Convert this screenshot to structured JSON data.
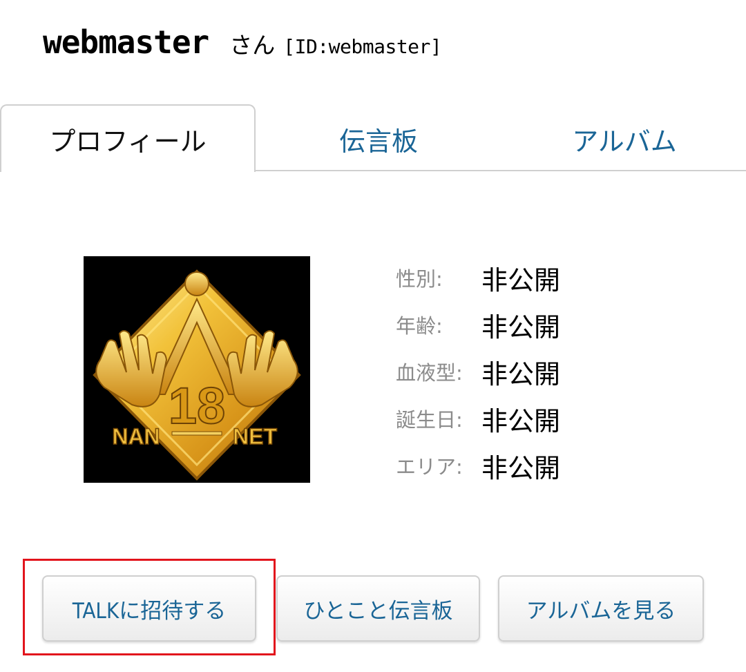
{
  "profile": {
    "username": "webmaster",
    "honorific": "さん",
    "id_label": "[ID:webmaster]"
  },
  "tabs": [
    {
      "label": "プロフィール",
      "active": true
    },
    {
      "label": "伝言板",
      "active": false
    },
    {
      "label": "アルバム",
      "active": false
    }
  ],
  "avatar": {
    "number": "18",
    "left_text": "NAN",
    "right_text": "NET"
  },
  "info": [
    {
      "label": "性別:",
      "value": "非公開"
    },
    {
      "label": "年齢:",
      "value": "非公開"
    },
    {
      "label": "血液型:",
      "value": "非公開"
    },
    {
      "label": "誕生日:",
      "value": "非公開"
    },
    {
      "label": "エリア:",
      "value": "非公開"
    }
  ],
  "buttons": {
    "invite": "TALKに招待する",
    "board": "ひとこと伝言板",
    "album": "アルバムを見る"
  },
  "colors": {
    "link": "#1a6596",
    "highlight": "#e2141c",
    "gold": "#e3a51f"
  }
}
